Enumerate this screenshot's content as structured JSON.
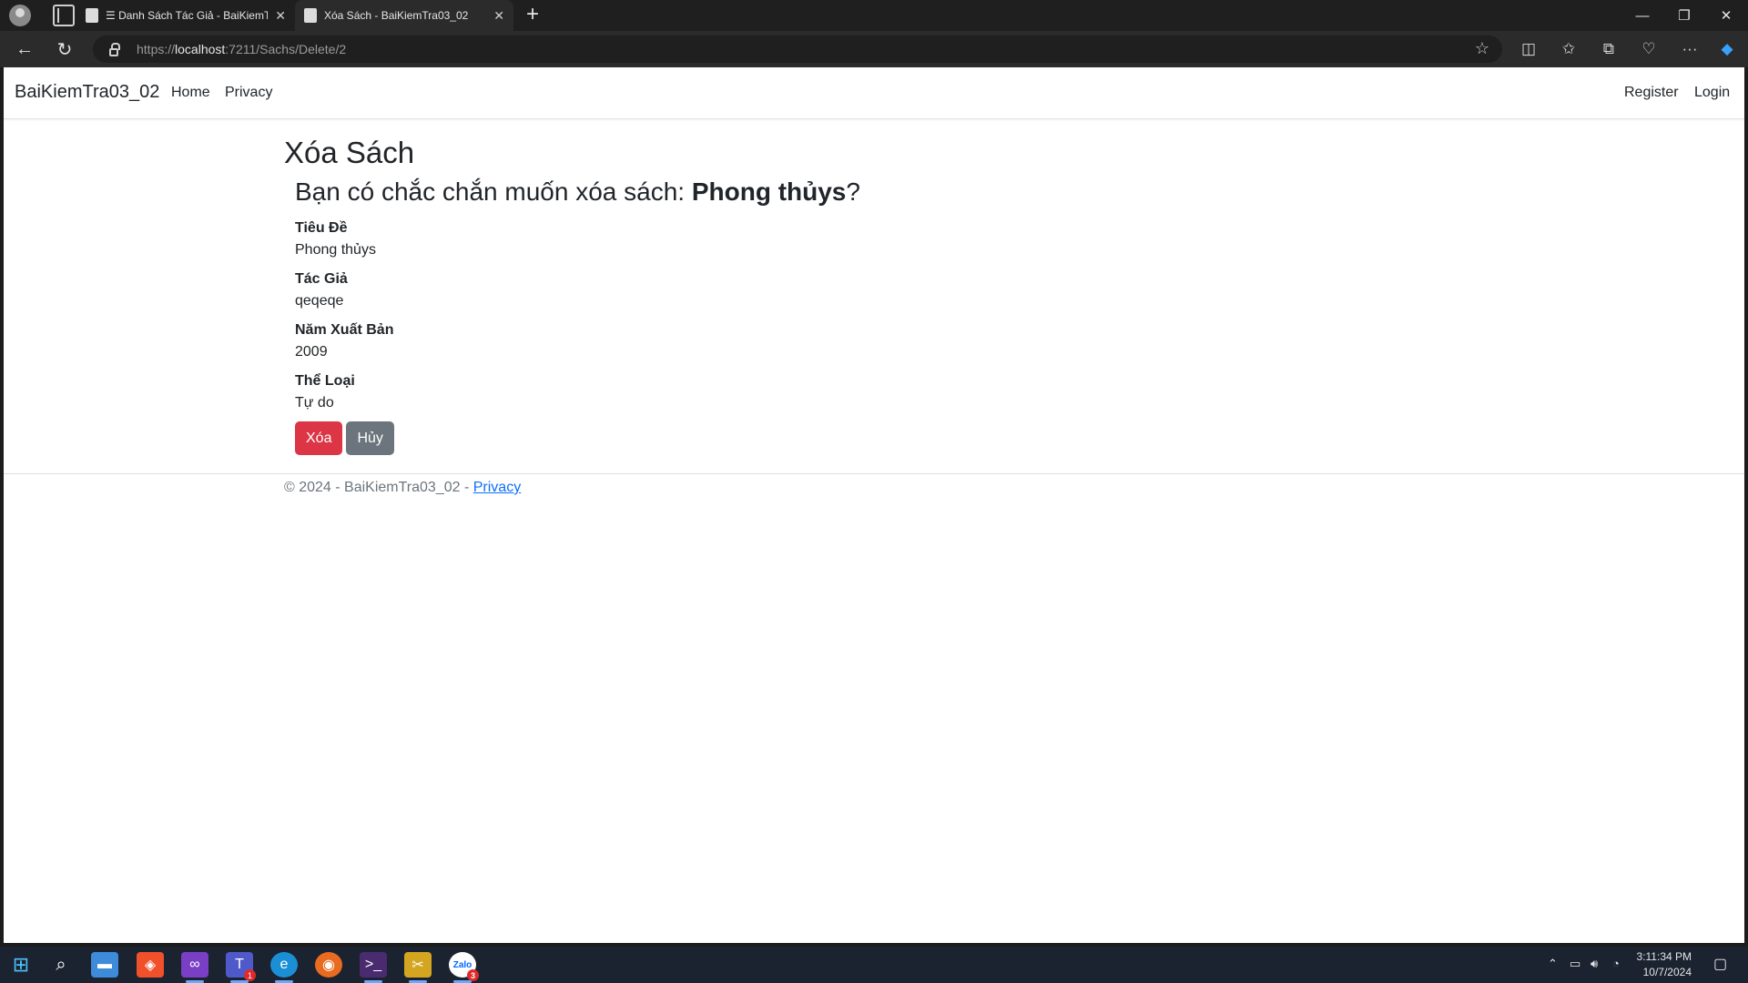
{
  "browser": {
    "tabs": [
      {
        "title": "☰ Danh Sách Tác Giả - BaiKiemTra03_02",
        "close": "✕"
      },
      {
        "title": "Xóa Sách - BaiKiemTra03_02",
        "close": "✕"
      }
    ],
    "new_tab": "+",
    "url_prefix": "https://",
    "url_host": "localhost",
    "url_rest": ":7211/Sachs/Delete/2",
    "window_controls": {
      "minimize": "—",
      "restore": "❐",
      "close": "✕"
    }
  },
  "navbar": {
    "brand": "BaiKiemTra03_02",
    "links": [
      "Home",
      "Privacy"
    ],
    "right_links": [
      "Register",
      "Login"
    ]
  },
  "page": {
    "title": "Xóa Sách",
    "confirm_prefix": "Bạn có chắc chắn muốn xóa sách: ",
    "confirm_book": "Phong thủys",
    "confirm_suffix": "?",
    "fields": [
      {
        "label": "Tiêu Đề",
        "value": "Phong thủys"
      },
      {
        "label": "Tác Giả",
        "value": "qeqeqe"
      },
      {
        "label": "Năm Xuất Bản",
        "value": "2009"
      },
      {
        "label": "Thể Loại",
        "value": "Tự do"
      }
    ],
    "delete_button": "Xóa",
    "cancel_button": "Hủy"
  },
  "footer": {
    "text": "© 2024 - BaiKiemTra03_02 - ",
    "privacy_link": "Privacy"
  },
  "taskbar": {
    "time": "3:11:34 PM",
    "date": "10/7/2024",
    "teams_badge": "1",
    "zalo_badge": "3",
    "zalo_label": "Zalo"
  },
  "colors": {
    "danger": "#dc3545",
    "secondary": "#6c757d",
    "link": "#0d6efd"
  }
}
